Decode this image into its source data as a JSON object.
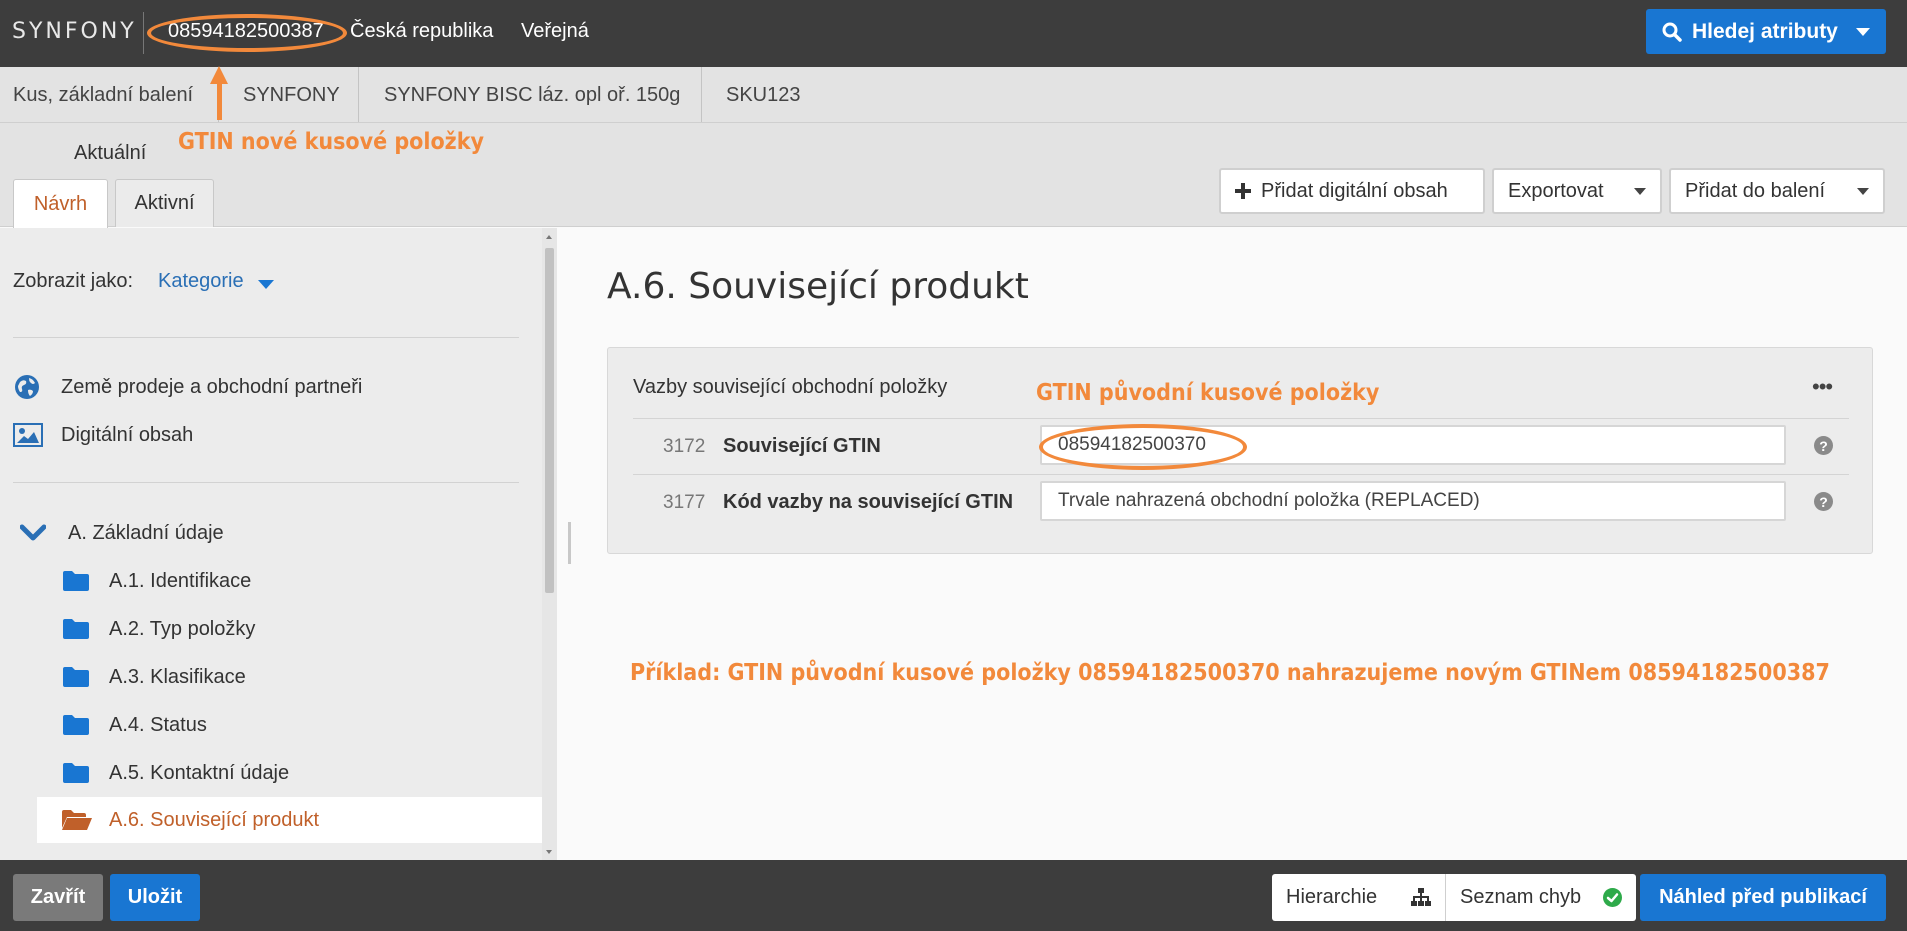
{
  "header": {
    "brand": "SYNFONY",
    "gtin": "08594182500387",
    "country": "Česká republika",
    "visibility": "Veřejná",
    "search_button": "Hledej atributy"
  },
  "breadcrumb": {
    "items": [
      "Kus, základní balení",
      "SYNFONY",
      "SYNFONY BISC láz. opl oř. 150g",
      "SKU123"
    ]
  },
  "tabs": {
    "current_label": "Aktuální",
    "design": "Návrh",
    "active": "Aktivní"
  },
  "toolbar": {
    "add_digital": "Přidat digitální obsah",
    "export": "Exportovat",
    "add_to_package": "Přidat do balení"
  },
  "annotations": {
    "top": "GTIN nové kusové položky",
    "middle": "GTIN původní kusové položky",
    "bottom": "Příklad: GTIN původní kusové položky 08594182500370 nahrazujeme novým GTINem 08594182500387",
    "color": "#f2893b"
  },
  "sidebar": {
    "show_as_label": "Zobrazit jako:",
    "show_as_value": "Kategorie",
    "top_items": [
      {
        "label": "Země prodeje a obchodní partneři",
        "icon": "globe-icon"
      },
      {
        "label": "Digitální obsah",
        "icon": "image-icon"
      }
    ],
    "section": {
      "label": "A. Základní údaje",
      "icon": "chevron-down-icon"
    },
    "children": [
      {
        "label": "A.1. Identifikace",
        "icon": "folder-icon"
      },
      {
        "label": "A.2. Typ položky",
        "icon": "folder-icon"
      },
      {
        "label": "A.3. Klasifikace",
        "icon": "folder-icon"
      },
      {
        "label": "A.4. Status",
        "icon": "folder-icon"
      },
      {
        "label": "A.5. Kontaktní údaje",
        "icon": "folder-icon"
      },
      {
        "label": "A.6. Související produkt",
        "icon": "folder-open-icon"
      }
    ]
  },
  "main": {
    "title": "A.6. Související produkt",
    "panel": {
      "title": "Vazby související obchodní položky",
      "rows": [
        {
          "number": "3172",
          "label": "Související GTIN",
          "value": "08594182500370"
        },
        {
          "number": "3177",
          "label": "Kód vazby na související GTIN",
          "value": "Trvale nahrazená obchodní položka (REPLACED)"
        }
      ]
    }
  },
  "footer": {
    "close": "Zavřít",
    "save": "Uložit",
    "hierarchy": "Hierarchie",
    "errors": "Seznam chyb",
    "preview": "Náhled před publikací"
  },
  "colors": {
    "accent": "#1976d2",
    "selected_text": "#c0602a",
    "dark_bar": "#3d3d3d",
    "ok_green": "#2eaa4a"
  }
}
